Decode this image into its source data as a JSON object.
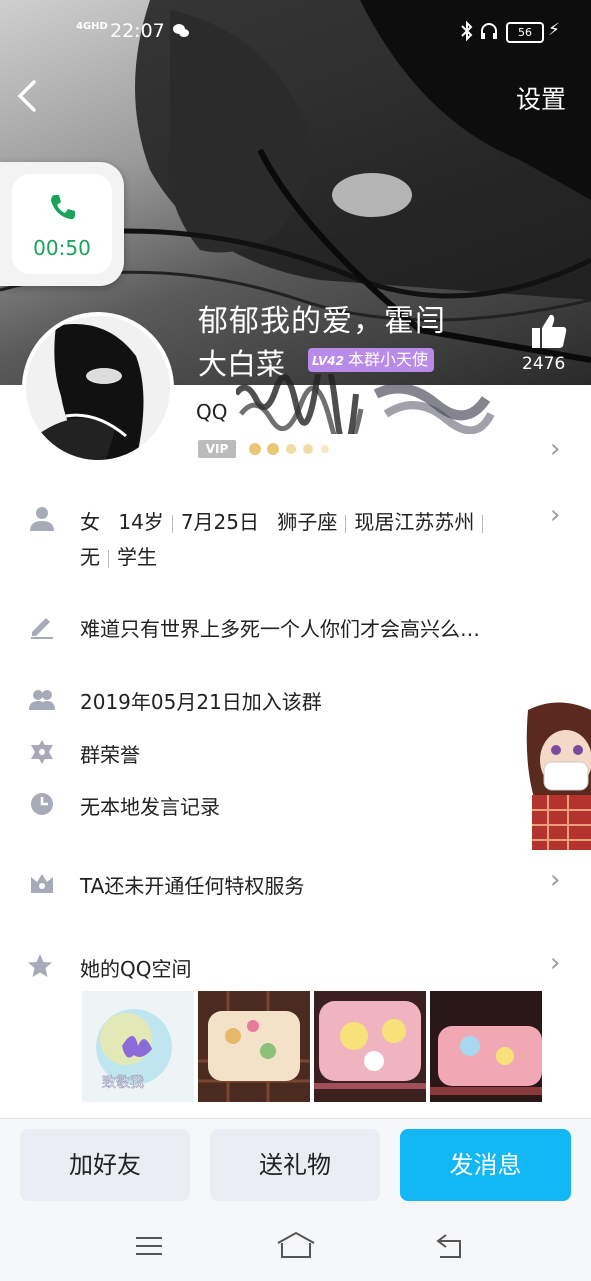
{
  "status_bar": {
    "network": "4GHD",
    "time": "22:07",
    "battery": "56"
  },
  "header": {
    "settings_label": "设置",
    "call_duration": "00:50",
    "nickname": "郁郁我的爱，霍闫",
    "group_name": "大白菜",
    "level": "LV42",
    "group_title": "本群小天使",
    "like_count": "2476"
  },
  "profile": {
    "qq_label": "QQ",
    "vip_label": "VIP"
  },
  "info": {
    "items_line1": [
      "女",
      "14岁",
      "7月25日",
      "狮子座",
      "现居江苏苏州"
    ],
    "items_line2": [
      "无",
      "学生"
    ],
    "signature": "难道只有世界上多死一个人你们才会高兴么…",
    "join_date": "2019年05月21日加入该群",
    "group_honor": "群荣誉",
    "speak_record": "无本地发言记录",
    "privilege": "TA还未开通任何特权服务",
    "qzone": "她的QQ空间",
    "photo_caption": "致敬我"
  },
  "actions": {
    "add_friend": "加好友",
    "send_gift": "送礼物",
    "send_message": "发消息"
  },
  "colors": {
    "accent_blue": "#12b7f5",
    "call_green": "#1aa35a",
    "badge_purple": "#b88be8"
  }
}
